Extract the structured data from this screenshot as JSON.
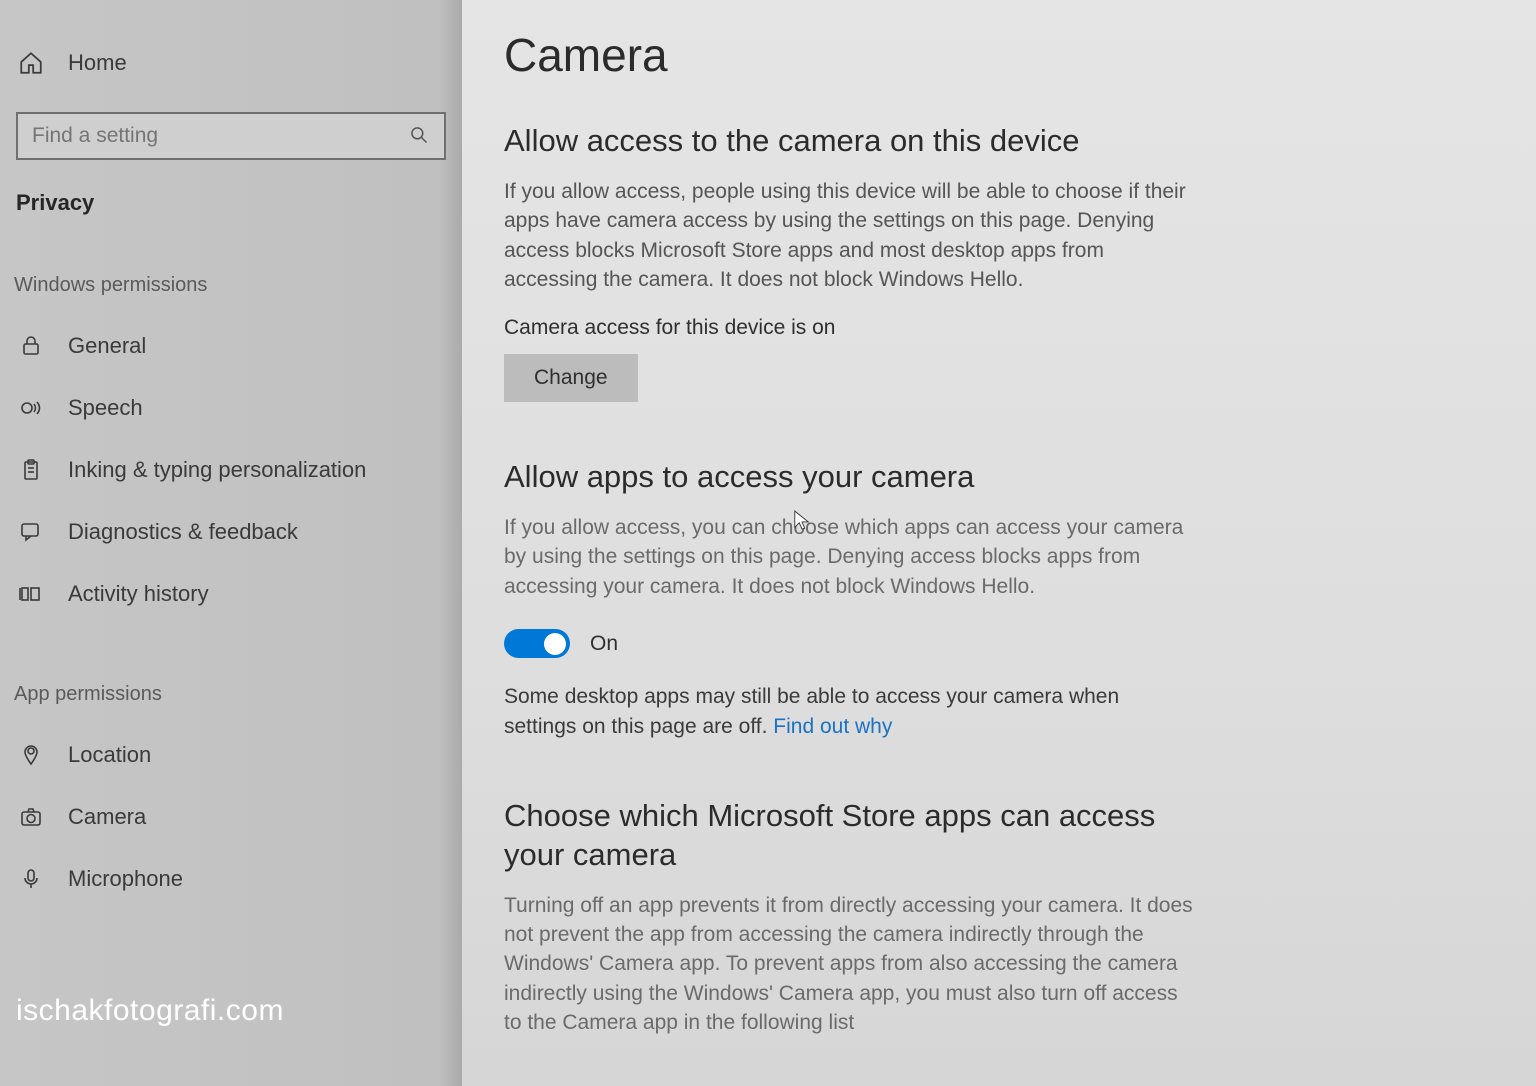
{
  "sidebar": {
    "home": "Home",
    "search_placeholder": "Find a setting",
    "category": "Privacy",
    "group1_label": "Windows permissions",
    "group1_items": [
      {
        "icon": "lock",
        "label": "General"
      },
      {
        "icon": "speech",
        "label": "Speech"
      },
      {
        "icon": "clipboard",
        "label": "Inking & typing personalization"
      },
      {
        "icon": "feedback",
        "label": "Diagnostics & feedback"
      },
      {
        "icon": "history",
        "label": "Activity history"
      }
    ],
    "group2_label": "App permissions",
    "group2_items": [
      {
        "icon": "location",
        "label": "Location"
      },
      {
        "icon": "camera",
        "label": "Camera"
      },
      {
        "icon": "microphone",
        "label": "Microphone"
      }
    ]
  },
  "main": {
    "title": "Camera",
    "section1": {
      "heading": "Allow access to the camera on this device",
      "body": "If you allow access, people using this device will be able to choose if their apps have camera access by using the settings on this page. Denying access blocks Microsoft Store apps and most desktop apps from accessing the camera. It does not block Windows Hello.",
      "status": "Camera access for this device is on",
      "button": "Change"
    },
    "section2": {
      "heading": "Allow apps to access your camera",
      "body": "If you allow access, you can choose which apps can access your camera by using the settings on this page. Denying access blocks apps from accessing your camera. It does not block Windows Hello.",
      "toggle_state": "On",
      "note_text": "Some desktop apps may still be able to access your camera when settings on this page are off. ",
      "note_link": "Find out why"
    },
    "section3": {
      "heading": "Choose which Microsoft Store apps can access your camera",
      "body": "Turning off an app prevents it from directly accessing your camera. It does not prevent the app from accessing the camera indirectly through the Windows' Camera app. To prevent apps from also accessing the camera indirectly using the Windows' Camera app, you must also turn off access to the Camera app in the following list"
    }
  },
  "watermark": "ischakfotografi.com"
}
